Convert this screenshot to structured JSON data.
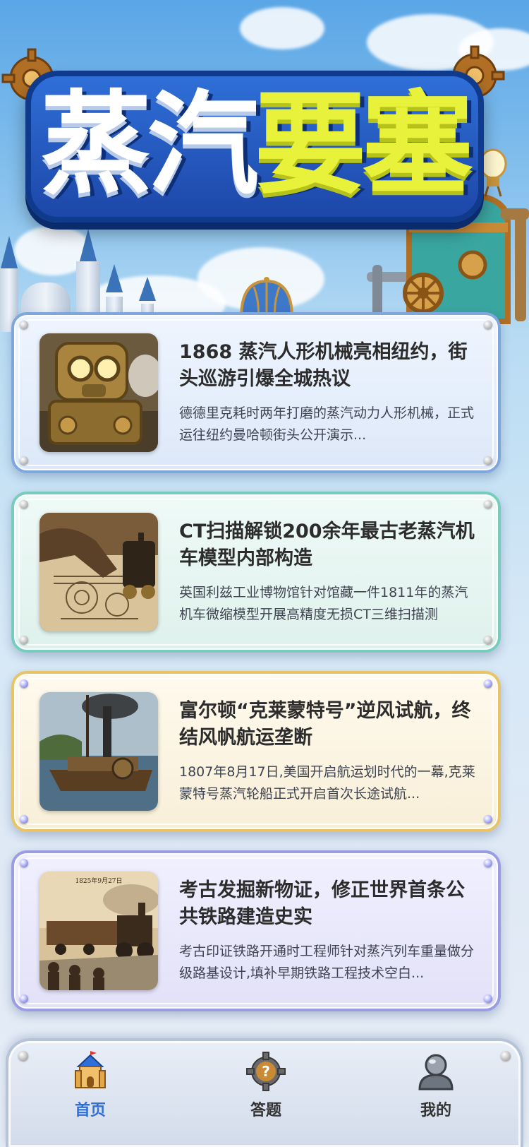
{
  "app": {
    "title_part1": "蒸汽",
    "title_part2": "要塞"
  },
  "news": [
    {
      "theme": "blue",
      "image_icon": "steam-robot-image",
      "headline": "1868 蒸汽人形机械亮相纽约，街头巡游引爆全城热议",
      "summary": "德德里克耗时两年打磨的蒸汽动力人形机械，正式运往纽约曼哈顿街头公开演示..."
    },
    {
      "theme": "teal",
      "image_icon": "locomotive-blueprint-image",
      "headline": "CT扫描解锁200余年最古老蒸汽机车模型内部构造",
      "summary": "英国利兹工业博物馆针对馆藏一件1811年的蒸汽机车微缩模型开展高精度无损CT三维扫描测"
    },
    {
      "theme": "gold",
      "image_icon": "steamboat-image",
      "headline": "富尔顿“克莱蒙特号”逆风试航，终结风帆航运垄断",
      "summary": "1807年8月17日,美国开启航运划时代的一幕,克莱蒙特号蒸汽轮船正式开启首次长途试航..."
    },
    {
      "theme": "purple",
      "image_icon": "railway-crowd-image",
      "image_caption": "1825年9月27日",
      "headline": "考古发掘新物证，修正世界首条公共铁路建造史实",
      "summary": "考古印证铁路开通时工程师针对蒸汽列车重量做分级路基设计,填补早期铁路工程技术空白..."
    }
  ],
  "nav": {
    "items": [
      {
        "label": "首页",
        "icon": "castle-icon",
        "active": true
      },
      {
        "label": "答题",
        "icon": "question-gear-icon",
        "active": false
      },
      {
        "label": "我的",
        "icon": "profile-avatar-icon",
        "active": false
      }
    ]
  },
  "colors": {
    "primary_blue": "#2f6fd8",
    "title_yellow": "#e9f23a",
    "card_blue_border": "#7fa7de",
    "card_teal_border": "#76cdbb",
    "card_gold_border": "#e9c467",
    "card_purple_border": "#9a9ce4"
  }
}
